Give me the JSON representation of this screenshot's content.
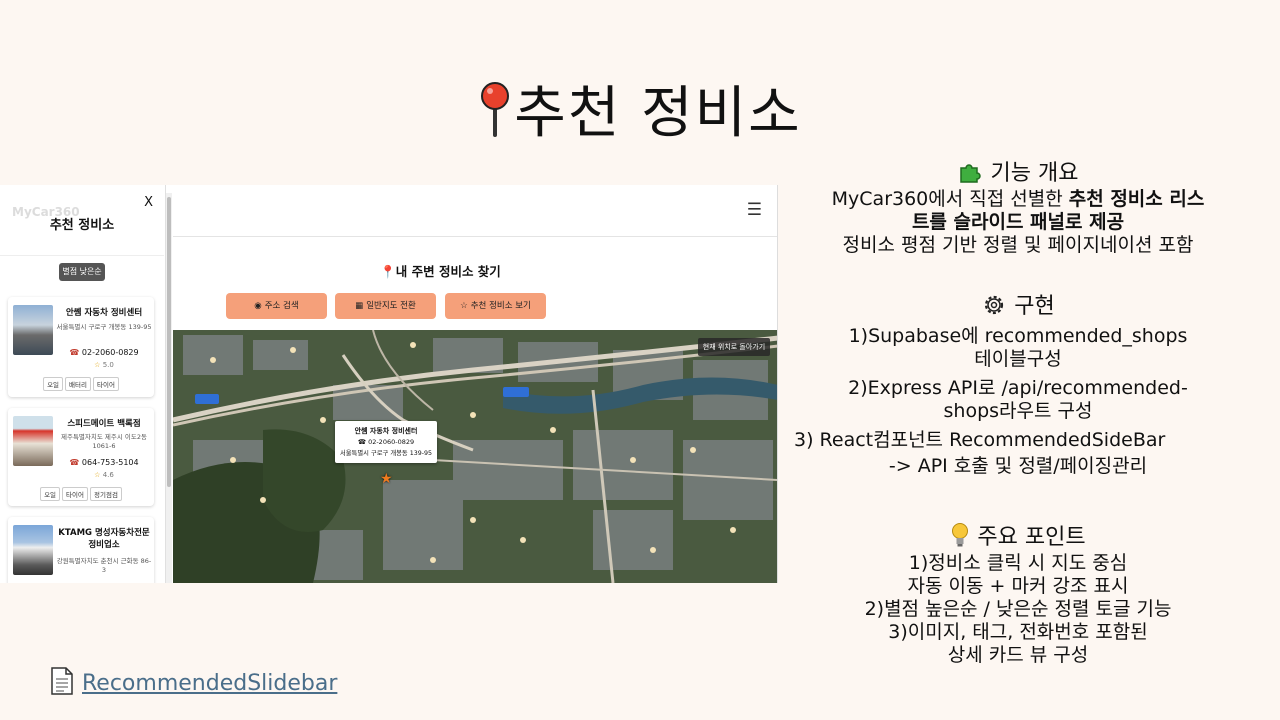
{
  "slide": {
    "title": "추천 정비소",
    "link_text": "RecommendedSlidebar"
  },
  "panel": {
    "ghost_logo": "MyCar360",
    "close": "X",
    "title": "추천 정비소",
    "sort_button": "별점 낮은순",
    "shops": [
      {
        "name": "안쎔 자동차 정비센터",
        "address": "서울특별시 구로구 개봉동 139-95",
        "phone": "02-2060-0829",
        "rating": "5.0",
        "tags": [
          "오일",
          "배터리",
          "타이어"
        ]
      },
      {
        "name": "스피드메이트 백록점",
        "address": "제주특별자치도 제주시 이도2동 1061-6",
        "phone": "064-753-5104",
        "rating": "4.6",
        "tags": [
          "오일",
          "타이어",
          "정기점검"
        ]
      },
      {
        "name": "KTAMG 명성자동차전문정비업소",
        "address": "강원특별자치도 춘천시 근화동 86-3"
      }
    ]
  },
  "map_page": {
    "menu_icon": "☰",
    "title": "내 주변 정비소 찾기",
    "buttons": {
      "address_search": "주소 검색",
      "map_toggle": "일반지도 전환",
      "recommended": "추천 정비소 보기"
    },
    "return_button": "현재 위치로 돌아가기",
    "popup": {
      "name": "안쎔 자동차 정비센터",
      "phone": "02-2060-0829",
      "address": "서울특별시 구로구 개봉동 139-95"
    }
  },
  "overview": {
    "heading": "기능 개요",
    "line1_pre": "MyCar360에서 직접 선별한 ",
    "line1_bold": "추천 정비소 리스",
    "line2_bold": "트를 슬라이드 패널로 제공",
    "line3": "정비소 평점 기반 정렬 및 페이지네이션 포함"
  },
  "implementation": {
    "heading": "구현",
    "lines": [
      "1)Supabase에 recommended_shops",
      "테이블구성",
      "2)Express API로 /api/recommended-",
      "shops라우트 구성",
      "3)   React컴포넌트 RecommendedSideBar",
      "-> API 호출 및 정렬/페이징관리"
    ]
  },
  "key_points": {
    "heading": "주요 포인트",
    "lines": [
      "1)정비소 클릭 시 지도 중심",
      "자동 이동 + 마커 강조 표시",
      "2)별점 높은순 / 낮은순 정렬 토글 기능",
      "3)이미지, 태그, 전화번호 포함된",
      "상세 카드 뷰 구성"
    ]
  },
  "icons": {
    "title": "round-pushpin-icon",
    "overview": "puzzle-piece-icon",
    "implementation": "gear-icon",
    "key_points": "light-bulb-icon",
    "link": "document-icon"
  },
  "colors": {
    "background": "#fdf7f2",
    "button": "#f5a07a",
    "link": "#4a6e8a",
    "pin": "#e8412c"
  }
}
